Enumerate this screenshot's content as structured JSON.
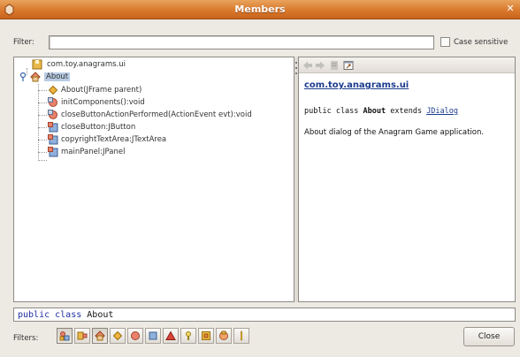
{
  "window": {
    "title": "Members"
  },
  "filter": {
    "label": "Filter:",
    "value": "",
    "case_sensitive_label": "Case sensitive",
    "case_sensitive_checked": false
  },
  "tree": {
    "nodes": [
      {
        "label": "com.toy.anagrams.ui",
        "icon": "package-icon"
      },
      {
        "label": "About",
        "icon": "class-icon",
        "selected": true
      },
      {
        "label": "About(JFrame parent)",
        "icon": "constructor-icon"
      },
      {
        "label": "initComponents():void",
        "icon": "private-method-icon"
      },
      {
        "label": "closeButtonActionPerformed(ActionEvent evt):void",
        "icon": "private-method-icon"
      },
      {
        "label": "closeButton:JButton",
        "icon": "private-field-icon"
      },
      {
        "label": "copyrightTextArea:JTextArea",
        "icon": "private-field-icon"
      },
      {
        "label": "mainPanel:JPanel",
        "icon": "private-field-icon"
      }
    ]
  },
  "javadoc": {
    "package_link": "com.toy.anagrams.ui",
    "decl_prefix": "public class ",
    "decl_class": "About",
    "decl_extends": " extends ",
    "decl_super": "JDialog",
    "description": "About dialog of the Anagram Game application."
  },
  "signature": {
    "keyword": "public class",
    "name": "About"
  },
  "bottom": {
    "filters_label": "Filters:",
    "filter_buttons": [
      "inherited-members-icon",
      "show-fqn-icon",
      "sort-by-type-icon",
      "constructor-filter-icon",
      "method-filter-icon",
      "field-filter-icon",
      "static-filter-icon",
      "non-public-filter-icon",
      "inner-class-filter-icon",
      "hierarchy-filter-icon",
      "separator-icon"
    ],
    "close_label": "Close"
  },
  "colors": {
    "titlebar": "#d9792d",
    "link": "#1b3c8e",
    "selection": "#b9cbe4"
  }
}
